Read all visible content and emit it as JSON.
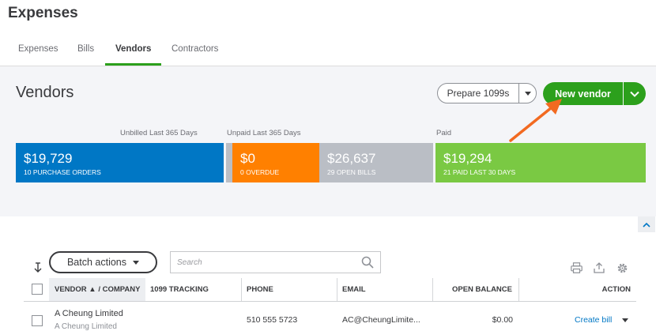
{
  "app": {
    "title": "Expenses"
  },
  "tabs": [
    {
      "label": "Expenses",
      "active": false
    },
    {
      "label": "Bills",
      "active": false
    },
    {
      "label": "Vendors",
      "active": true
    },
    {
      "label": "Contractors",
      "active": false
    }
  ],
  "page": {
    "title": "Vendors"
  },
  "actions": {
    "prepare_label": "Prepare 1099s",
    "new_vendor_label": "New vendor"
  },
  "summary": {
    "labels": {
      "unbilled": "Unbilled Last 365 Days",
      "unpaid": "Unpaid Last 365 Days",
      "paid": "Paid"
    },
    "purchase_orders": {
      "amount": "$19,729",
      "sub": "10 PURCHASE ORDERS",
      "color": "#0077c5"
    },
    "overdue": {
      "amount": "$0",
      "sub": "0 OVERDUE",
      "color": "#ff8000"
    },
    "open_bills": {
      "amount": "$26,637",
      "sub": "29 OPEN BILLS",
      "color": "#babec5"
    },
    "paid": {
      "amount": "$19,294",
      "sub": "21 PAID LAST 30 DAYS",
      "color": "#7ac943"
    }
  },
  "toolbar": {
    "batch_label": "Batch actions",
    "search_placeholder": "Search"
  },
  "table": {
    "headers": {
      "vendor": "VENDOR ▲ / COMPANY",
      "tracking": "1099 TRACKING",
      "phone": "PHONE",
      "email": "EMAIL",
      "balance": "OPEN BALANCE",
      "action": "ACTION"
    },
    "rows": [
      {
        "vendor": "A Cheung Limited",
        "company": "A Cheung Limited",
        "phone": "510 555 5723",
        "email": "AC@CheungLimite...",
        "balance": "$0.00",
        "action": "Create bill"
      }
    ]
  },
  "colors": {
    "accent": "#2ca01c",
    "link": "#0077c5",
    "arrow": "#f26a21"
  }
}
